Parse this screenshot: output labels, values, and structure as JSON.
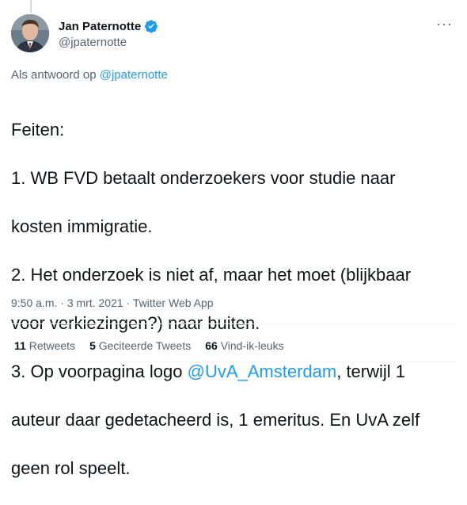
{
  "author": {
    "display_name": "Jan Paternotte",
    "handle": "@jpaternotte",
    "verified": true,
    "avatar_icon": "profile-photo"
  },
  "more_icon": "ellipsis-icon",
  "reply": {
    "prefix": "Als antwoord op",
    "to": "@jpaternotte"
  },
  "tweet": {
    "line1": "Feiten:",
    "line2": "1. WB FVD betaalt onderzoekers voor studie naar",
    "line3": "kosten immigratie.",
    "line4": "2. Het onderzoek is niet af, maar het moet (blijkbaar",
    "line5": "voor verkiezingen?) naar buiten.",
    "line6_pre": "3. Op voorpagina logo ",
    "line6_mention": "@UvA_Amsterdam",
    "line6_post": ", terwijl 1",
    "line7": "auteur daar gedetacheerd is, 1 emeritus. En UvA zelf",
    "line8": "geen rol speelt."
  },
  "meta": {
    "time": "9:50 a.m.",
    "sep1": " · ",
    "date": "3 mrt. 2021",
    "sep2": " · ",
    "source": "Twitter Web App"
  },
  "stats": {
    "retweets_count": "11",
    "retweets_label": "Retweets",
    "quotes_count": "5",
    "quotes_label": "Geciteerde Tweets",
    "likes_count": "66",
    "likes_label": "Vind-ik-leuks"
  },
  "colors": {
    "accent": "#1d9bf0",
    "text": "#0f1419",
    "secondary": "#536471"
  }
}
